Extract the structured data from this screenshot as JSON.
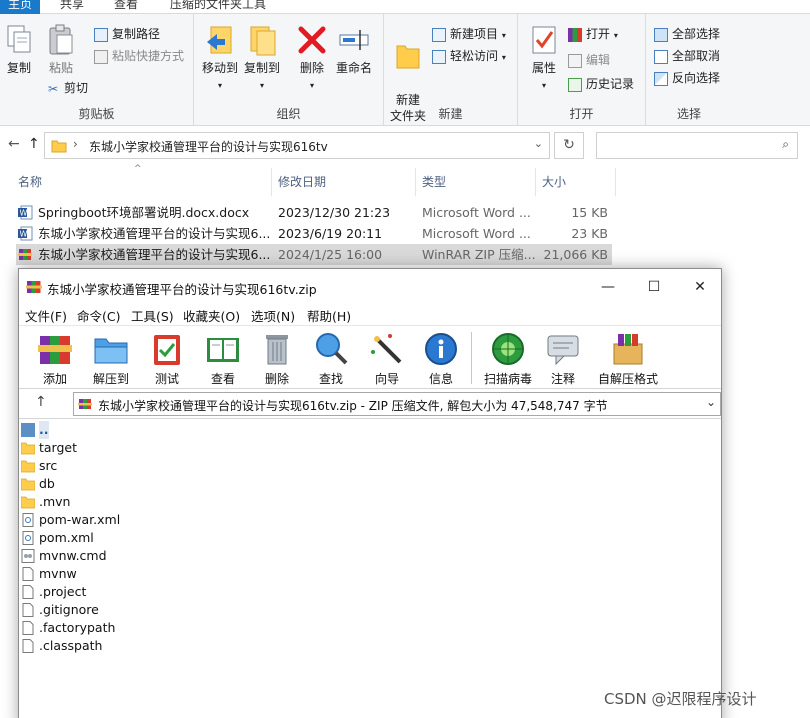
{
  "explorer": {
    "tabs": [
      "主页",
      "共享",
      "查看",
      "压缩的文件夹工具"
    ],
    "clipboard": {
      "label": "剪贴板",
      "copy": "复制",
      "paste": "粘贴",
      "copy_path": "复制路径",
      "paste_shortcut": "粘贴快捷方式",
      "cut": "剪切"
    },
    "organize": {
      "label": "组织",
      "move_to": "移动到",
      "copy_to": "复制到",
      "delete": "删除",
      "rename": "重命名"
    },
    "new": {
      "label": "新建",
      "new_folder": "新建\n文件夹",
      "new_item": "新建项目",
      "easy_access": "轻松访问"
    },
    "open": {
      "label": "打开",
      "properties": "属性",
      "open": "打开",
      "edit": "编辑",
      "history": "历史记录"
    },
    "select": {
      "label": "选择",
      "select_all": "全部选择",
      "select_none": "全部取消",
      "invert": "反向选择"
    },
    "address": "东城小学家校通管理平台的设计与实现616tv",
    "columns": {
      "name": "名称",
      "date": "修改日期",
      "type": "类型",
      "size": "大小"
    },
    "files": [
      {
        "name": "Springboot环境部署说明.docx.docx",
        "date": "2023/12/30 21:23",
        "type": "Microsoft Word ...",
        "size": "15 KB",
        "icon": "word"
      },
      {
        "name": "东城小学家校通管理平台的设计与实现6...",
        "date": "2023/6/19 20:11",
        "type": "Microsoft Word ...",
        "size": "23 KB",
        "icon": "word"
      },
      {
        "name": "东城小学家校通管理平台的设计与实现6...",
        "date": "2024/1/25 16:00",
        "type": "WinRAR ZIP 压缩...",
        "size": "21,066 KB",
        "icon": "rar"
      }
    ]
  },
  "winrar": {
    "title": "东城小学家校通管理平台的设计与实现616tv.zip",
    "menus": [
      "文件(F)",
      "命令(C)",
      "工具(S)",
      "收藏夹(O)",
      "选项(N)",
      "帮助(H)"
    ],
    "tools": [
      "添加",
      "解压到",
      "测试",
      "查看",
      "删除",
      "查找",
      "向导",
      "信息",
      "扫描病毒",
      "注释",
      "自解压格式"
    ],
    "address": "东城小学家校通管理平台的设计与实现616tv.zip - ZIP 压缩文件, 解包大小为 47,548,747 字节",
    "items": [
      {
        "name": "..",
        "icon": "up"
      },
      {
        "name": "target",
        "icon": "folder"
      },
      {
        "name": "src",
        "icon": "folder"
      },
      {
        "name": "db",
        "icon": "folder"
      },
      {
        "name": ".mvn",
        "icon": "folder"
      },
      {
        "name": "pom-war.xml",
        "icon": "xml"
      },
      {
        "name": "pom.xml",
        "icon": "xml"
      },
      {
        "name": "mvnw.cmd",
        "icon": "cmd"
      },
      {
        "name": "mvnw",
        "icon": "file"
      },
      {
        "name": ".project",
        "icon": "file"
      },
      {
        "name": ".gitignore",
        "icon": "file"
      },
      {
        "name": ".factorypath",
        "icon": "file"
      },
      {
        "name": ".classpath",
        "icon": "file"
      }
    ]
  },
  "watermark": "CSDN @迟限程序设计"
}
